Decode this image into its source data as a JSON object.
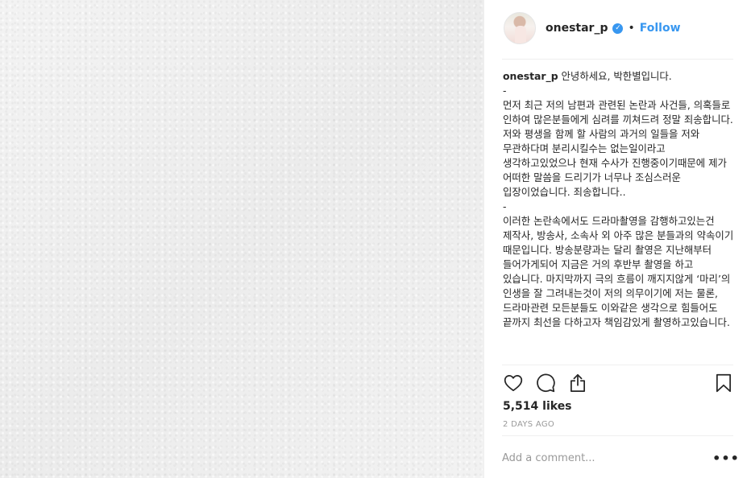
{
  "post": {
    "username": "onestar_p",
    "follow_label": "Follow",
    "dot": "•",
    "verified_glyph": "✓"
  },
  "caption": {
    "username": "onestar_p",
    "text": " 안녕하세요, 박한별입니다.\n-\n먼저 최근 저의 남편과 관련된 논란과 사건들, 의혹들로 인하여 많은분들에게 심려를 끼쳐드려 정말 죄송합니다.\n저와 평생을 함께 할 사람의 과거의 일들을 저와 무관하다며 분리시킬수는 없는일이라고 생각하고있었으나 현재 수사가 진행중이기때문에 제가 어떠한 말씀을 드리기가 너무나 조심스러운 입장이었습니다. 죄송합니다..\n-\n이러한 논란속에서도 드라마촬영을 감행하고있는건 제작사, 방송사, 소속사 외 아주 많은 분들과의 약속이기 때문입니다. 방송분량과는 달리 촬영은 지난해부터 들어가게되어 지금은 거의 후반부 촬영을 하고 있습니다. 마지막까지 극의 흐름이 깨지지않게 ‘마리’의 인생을 잘 그려내는것이 저의 의무이기에 저는 물론, 드라마관련 모든분들도 이와같은 생각으로 힘들어도 끝까지 최선을 다하고자 책임감있게 촬영하고있습니다."
  },
  "stats": {
    "likes": "5,514 likes",
    "time": "2 DAYS AGO"
  },
  "comment": {
    "placeholder": "Add a comment...",
    "more": "•••"
  },
  "icons": {
    "like": "heart-icon",
    "comment": "comment-icon",
    "share": "share-icon",
    "save": "bookmark-icon"
  },
  "colors": {
    "accent": "#3897f0",
    "text": "#262626",
    "muted": "#999999",
    "divider": "#efefef"
  }
}
